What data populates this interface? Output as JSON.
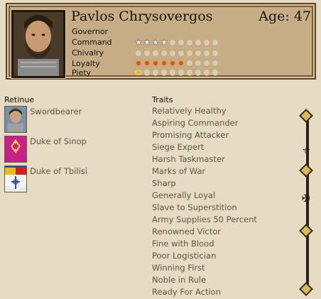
{
  "character": {
    "name": "Pavlos Chrysovergos",
    "age_label": "Age: 47",
    "role": "Governor"
  },
  "attributes": [
    {
      "label": "Command",
      "value": 4,
      "max": 10,
      "icon": "star-icon"
    },
    {
      "label": "Chivalry",
      "value": 0,
      "max": 10,
      "icon": "pip-icon"
    },
    {
      "label": "Loyalty",
      "value": 6,
      "max": 10,
      "icon": "loyalty-icon"
    },
    {
      "label": "Piety",
      "value": 1,
      "max": 10,
      "icon": "piety-halo-icon"
    }
  ],
  "retinue": {
    "header": "Retinue",
    "items": [
      {
        "label": "Swordbearer",
        "icon": "swordbearer-portrait-icon"
      },
      {
        "label": "Duke of Sinop",
        "icon": "sinop-banner-icon"
      },
      {
        "label": "Duke of Tbilisi",
        "icon": "tbilisi-banner-icon"
      }
    ]
  },
  "traits": {
    "header": "Traits",
    "items": [
      "Relatively Healthy",
      "Aspiring Commander",
      "Promising Attacker",
      "Siege Expert",
      "Harsh Taskmaster",
      "Marks of War",
      "Sharp",
      "Generally Loyal",
      "Slave to Superstition",
      "Army Supplies 50 Percent",
      "Renowned Victor",
      "Fine with Blood",
      "Poor Logistician",
      "Winning First",
      "Noble in Rule",
      "Ready For Action"
    ]
  },
  "colors": {
    "background": "#e6dcc3",
    "panel": "#c7ad86",
    "text_muted": "#5f5548",
    "scroll_diamond": "#d8b85a"
  }
}
